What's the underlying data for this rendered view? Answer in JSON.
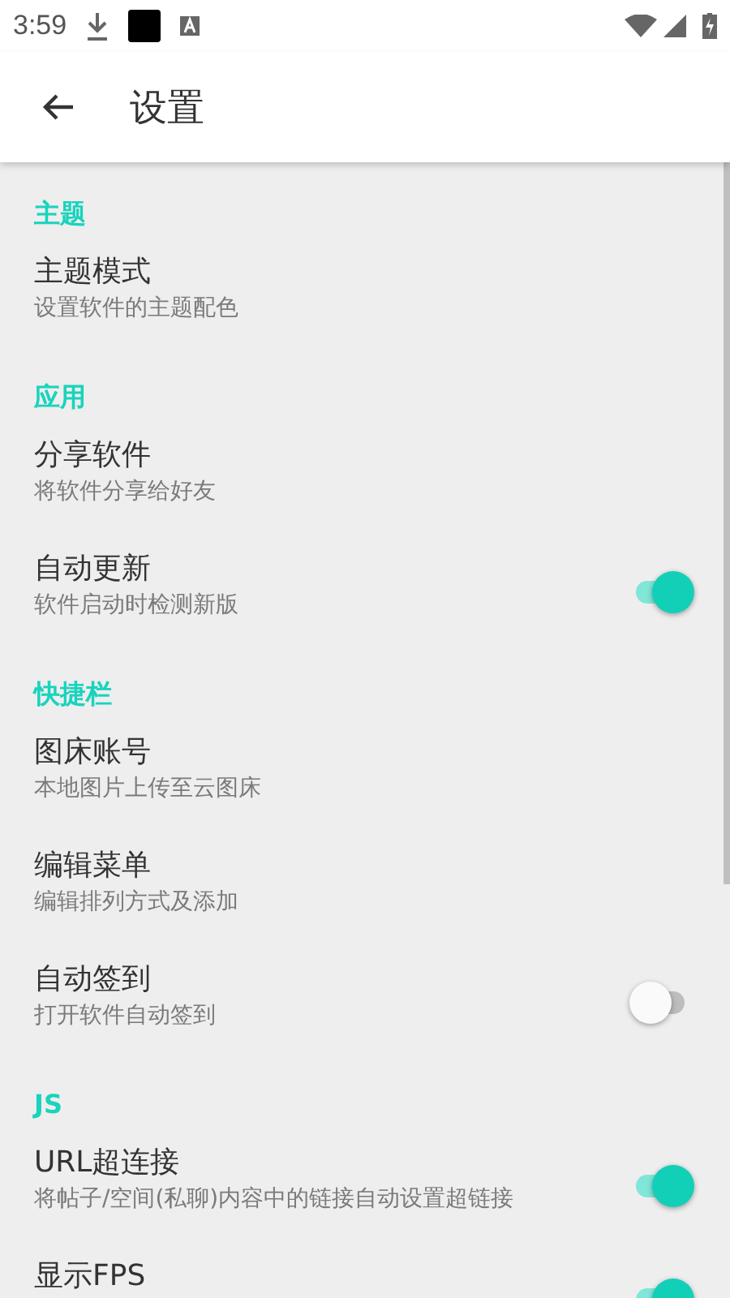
{
  "status_bar": {
    "time": "3:59"
  },
  "app_bar": {
    "title": "设置"
  },
  "sections": [
    {
      "title": "主题",
      "items": [
        {
          "kind": "link",
          "title": "主题模式",
          "summary": "设置软件的主题配色"
        }
      ]
    },
    {
      "title": "应用",
      "items": [
        {
          "kind": "link",
          "title": "分享软件",
          "summary": "将软件分享给好友"
        },
        {
          "kind": "toggle",
          "title": "自动更新",
          "summary": "软件启动时检测新版",
          "on": true
        }
      ]
    },
    {
      "title": "快捷栏",
      "items": [
        {
          "kind": "link",
          "title": "图床账号",
          "summary": "本地图片上传至云图床"
        },
        {
          "kind": "link",
          "title": "编辑菜单",
          "summary": "编辑排列方式及添加"
        },
        {
          "kind": "toggle",
          "title": "自动签到",
          "summary": "打开软件自动签到",
          "on": false
        }
      ]
    },
    {
      "title": "JS",
      "items": [
        {
          "kind": "toggle",
          "title": "URL超连接",
          "summary": "将帖子/空间(私聊)内容中的链接自动设置超链接",
          "on": true
        },
        {
          "kind": "toggle",
          "title": "显示FPS",
          "on": true
        }
      ]
    }
  ]
}
